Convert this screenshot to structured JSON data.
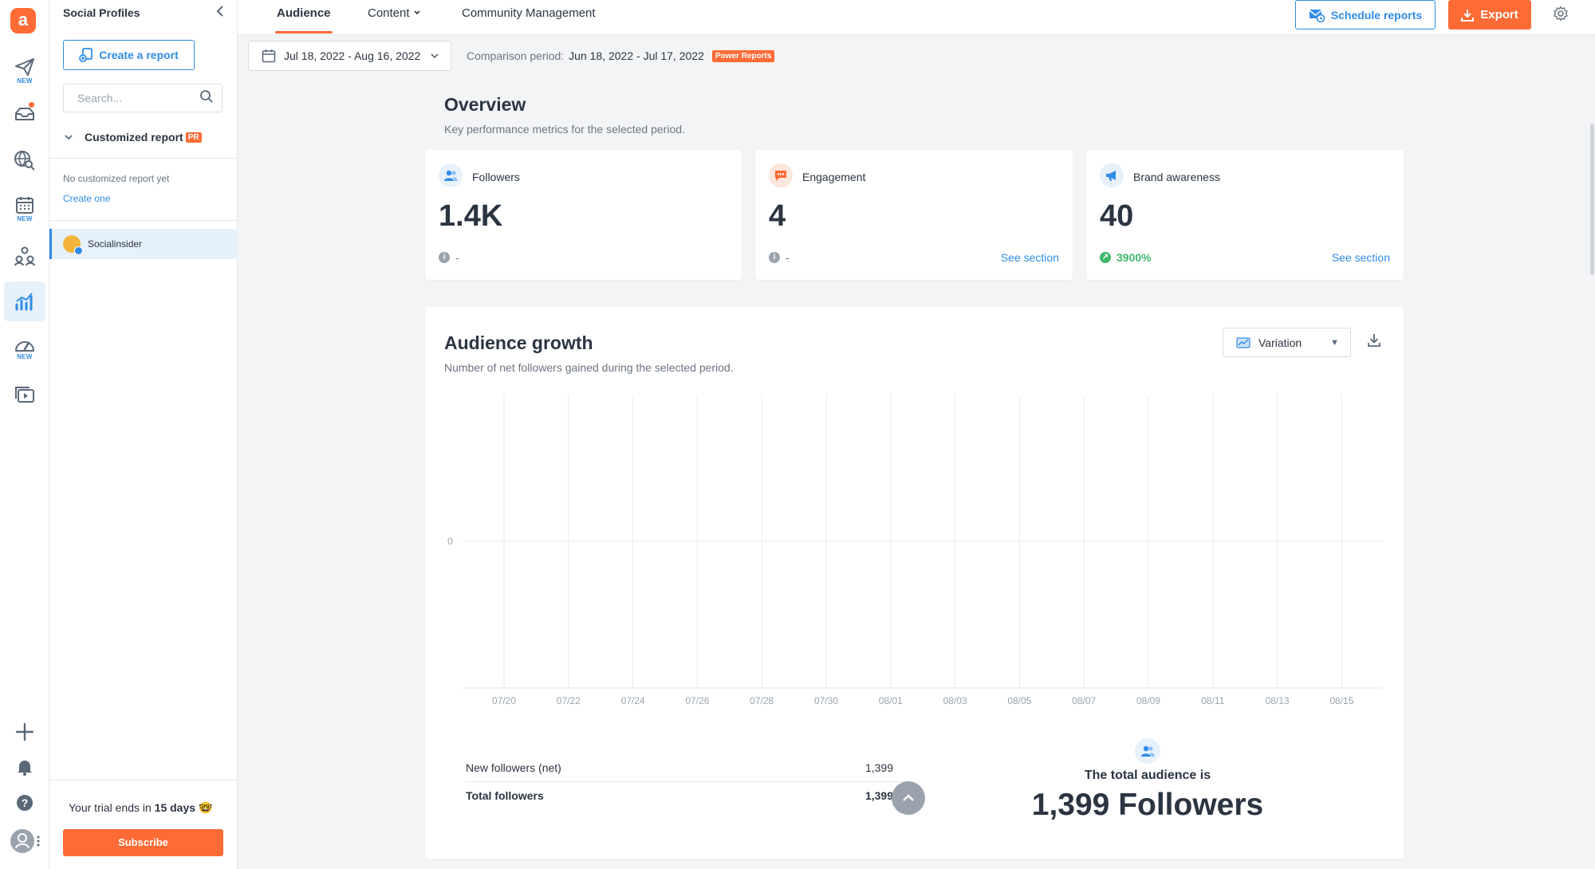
{
  "sidebar": {
    "title": "Social Profiles",
    "create_report": "Create a report",
    "search_placeholder": "Search...",
    "customized_report": "Customized report",
    "pr_badge": "PR",
    "no_report": "No customized report yet",
    "create_one": "Create one",
    "profile_name": "Socialinsider",
    "trial_prefix": "Your trial ends in",
    "trial_days": "15 days",
    "trial_emoji": "🤓",
    "subscribe": "Subscribe"
  },
  "rail": {
    "new_label": "NEW"
  },
  "topbar": {
    "tabs": [
      "Audience",
      "Content",
      "Community Management"
    ],
    "schedule": "Schedule reports",
    "export": "Export"
  },
  "datebar": {
    "range": "Jul 18, 2022 - Aug 16, 2022",
    "comparison_label": "Comparison period:",
    "comparison_value": "Jun 18, 2022 - Jul 17, 2022",
    "power_badge": "Power Reports"
  },
  "overview": {
    "title": "Overview",
    "subtitle": "Key performance metrics for the selected period.",
    "cards": [
      {
        "label": "Followers",
        "value": "1.4K",
        "change": "-",
        "link": ""
      },
      {
        "label": "Engagement",
        "value": "4",
        "change": "-",
        "link": "See section"
      },
      {
        "label": "Brand awareness",
        "value": "40",
        "change": "3900%",
        "link": "See section"
      }
    ]
  },
  "growth": {
    "title": "Audience growth",
    "subtitle": "Number of net followers gained during the selected period.",
    "variation": "Variation",
    "summary": {
      "new_label": "New followers (net)",
      "new_value": "1,399",
      "total_label": "Total followers",
      "total_value": "1,399"
    },
    "total_text": "The total audience is",
    "total_big": "1,399 Followers"
  },
  "colors": {
    "accent": "#ff6b35",
    "primary": "#2f8ce6",
    "positive": "#3fb86b"
  },
  "chart_data": {
    "type": "line",
    "x": [
      "07/20",
      "07/22",
      "07/24",
      "07/26",
      "07/28",
      "07/30",
      "08/01",
      "08/03",
      "08/05",
      "08/07",
      "08/09",
      "08/11",
      "08/13",
      "08/15"
    ],
    "y_ticks": [
      "0"
    ],
    "series": [],
    "grid": true
  }
}
